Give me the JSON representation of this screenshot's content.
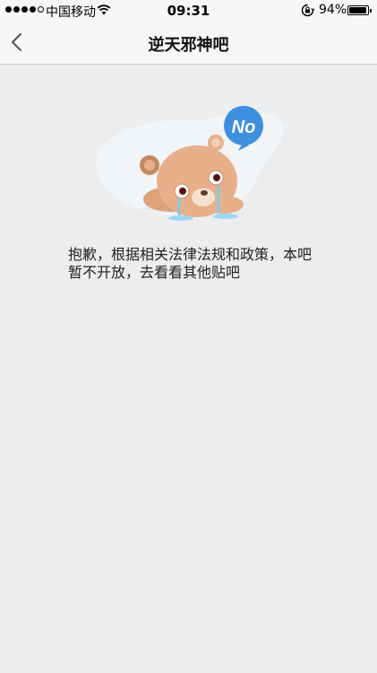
{
  "status_bar": {
    "signal_icon": "signal-dots-icon",
    "carrier": "中国移动",
    "wifi_icon": "wifi-icon",
    "time": "09:31",
    "orientation_lock_icon": "rotation-lock-icon",
    "battery_percent": "94%",
    "battery_level": 0.94
  },
  "nav": {
    "back_icon": "chevron-left-icon",
    "title": "逆天邪神吧"
  },
  "main": {
    "illustration": "crying-bear-no-bubble",
    "bubble_text": "No",
    "message_line1": "抱歉，根据相关法律法规和政策，本吧",
    "message_line2": "暂不开放，去看看其他贴吧"
  },
  "colors": {
    "background": "#ECEDEF",
    "bar_background": "#F7F7F8",
    "bubble_blue": "#3F8FE0",
    "bear_tan": "#E7B08B"
  }
}
